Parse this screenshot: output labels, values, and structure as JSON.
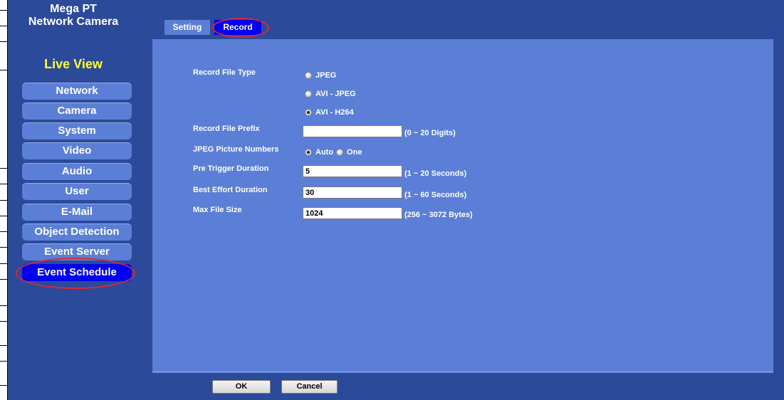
{
  "sidebar": {
    "brand_line1": "Mega PT",
    "brand_line2": "Network Camera",
    "live_view": "Live View",
    "items": [
      {
        "label": "Network"
      },
      {
        "label": "Camera"
      },
      {
        "label": "System"
      },
      {
        "label": "Video"
      },
      {
        "label": "Audio"
      },
      {
        "label": "User"
      },
      {
        "label": "E-Mail"
      },
      {
        "label": "Object Detection"
      },
      {
        "label": "Event Server"
      },
      {
        "label": "Event Schedule"
      }
    ],
    "active": "Event Schedule"
  },
  "tabs": [
    {
      "label": "Setting"
    },
    {
      "label": "Record"
    }
  ],
  "active_tab": "Record",
  "form": {
    "record_file_type": {
      "label": "Record File Type",
      "options": [
        "JPEG",
        "AVI - JPEG",
        "AVI - H264"
      ],
      "selected": "AVI - H264"
    },
    "record_file_prefix": {
      "label": "Record File Prefix",
      "value": "",
      "hint": "(0 ~ 20 Digits)"
    },
    "jpeg_picture_numbers": {
      "label": "JPEG Picture Numbers",
      "options": [
        "Auto",
        "One"
      ],
      "selected": "Auto"
    },
    "pre_trigger_duration": {
      "label": "Pre Trigger Duration",
      "value": "5",
      "hint": "(1 ~ 20 Seconds)"
    },
    "best_effort_duration": {
      "label": "Best Effort Duration",
      "value": "30",
      "hint": "(1 ~ 60 Seconds)"
    },
    "max_file_size": {
      "label": "Max File Size",
      "value": "1024",
      "hint": "(256 ~ 3072 Bytes)"
    }
  },
  "buttons": {
    "ok": "OK",
    "cancel": "Cancel"
  },
  "colors": {
    "background": "#2c4a9a",
    "panel": "#5b7fd6",
    "active": "#0000f0",
    "highlight_ring": "#d42a3a",
    "live_view": "#ffff33"
  }
}
